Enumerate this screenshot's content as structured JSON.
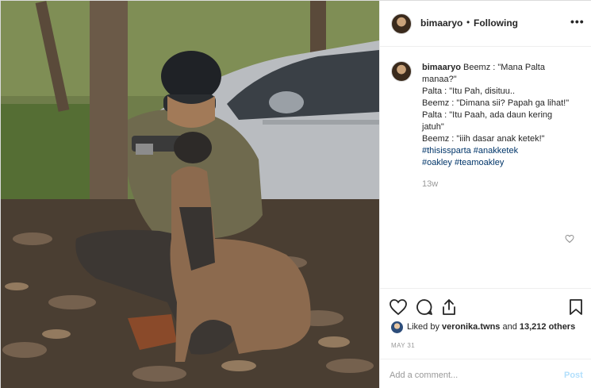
{
  "post": {
    "username": "bimaaryo",
    "separator": "•",
    "follow_status": "Following",
    "more_icon": "more-options-icon"
  },
  "caption": {
    "username": "bimaaryo",
    "first_line": "Beemz : \"Mana Palta",
    "lines": [
      "manaa?\"",
      "Palta : \"Itu Pah, disituu..",
      "Beemz : \"Dimana sii? Papah ga lihat!\"",
      "Palta : \"Itu Paah, ada daun kering",
      "jatuh\"",
      "Beemz : \"iiih dasar anak ketek!\""
    ],
    "hashtags_line1": "#thisissparta #anakketek",
    "hashtags_line2": "#oakley #teamoakley",
    "time_ago": "13w"
  },
  "actions": {
    "icons": [
      "heart-icon",
      "comment-icon",
      "share-icon",
      "bookmark-icon"
    ]
  },
  "likes": {
    "prefix": "Liked by",
    "user": "veronika.twns",
    "middle": "and",
    "count": "13,212 others"
  },
  "date": "MAY 31",
  "comment_box": {
    "placeholder": "Add a comment...",
    "post_label": "Post"
  },
  "colors": {
    "hashtag": "#003569",
    "post_button_disabled": "#b2dffc",
    "muted_text": "#999999",
    "border": "#efefef"
  }
}
